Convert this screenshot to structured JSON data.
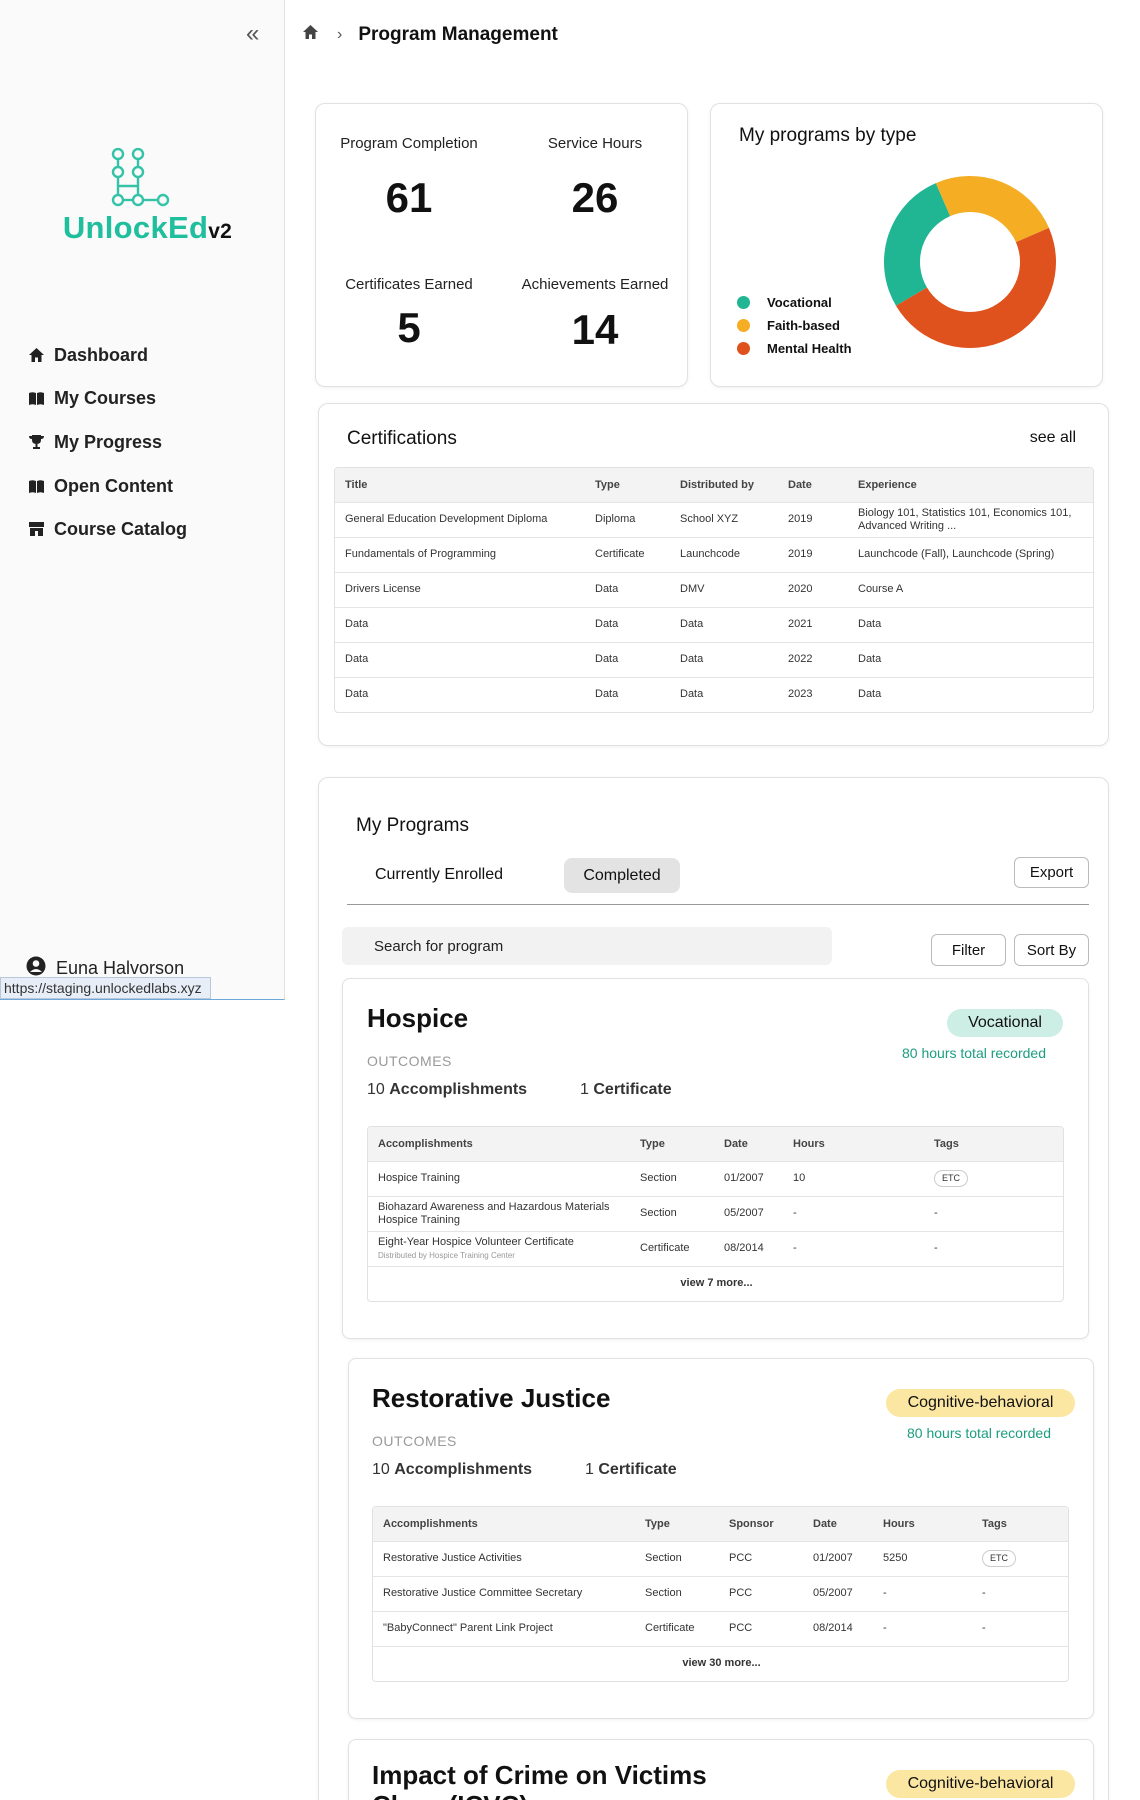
{
  "app": {
    "logo_text": "UnlockEd",
    "logo_version": "v2"
  },
  "sidebar": {
    "items": [
      {
        "label": "Dashboard",
        "icon": "home-icon"
      },
      {
        "label": "My Courses",
        "icon": "book-icon"
      },
      {
        "label": "My Progress",
        "icon": "trophy-icon"
      },
      {
        "label": "Open Content",
        "icon": "book-icon"
      },
      {
        "label": "Course Catalog",
        "icon": "store-icon"
      }
    ],
    "user_name": "Euna Halvorson",
    "url_tooltip": "https://staging.unlockedlabs.xyz"
  },
  "breadcrumb": {
    "title": "Program Management"
  },
  "stats": {
    "program_completion_label": "Program Completion",
    "program_completion_value": "61",
    "service_hours_label": "Service Hours",
    "service_hours_value": "26",
    "certificates_label": "Certificates Earned",
    "certificates_value": "5",
    "achievements_label": "Achievements Earned",
    "achievements_value": "14"
  },
  "programs_by_type": {
    "title": "My programs by type",
    "legend": [
      "Vocational",
      "Faith-based",
      "Mental Health"
    ]
  },
  "chart_data": {
    "type": "pie",
    "title": "My programs by type",
    "categories": [
      "Vocational",
      "Faith-based",
      "Mental Health"
    ],
    "values": [
      27,
      25,
      48
    ],
    "colors": [
      "#20b593",
      "#f5ae23",
      "#e0521d"
    ],
    "legend_position": "left"
  },
  "certifications": {
    "title": "Certifications",
    "see_all": "see all",
    "columns": [
      "Title",
      "Type",
      "Distributed by",
      "Date",
      "Experience"
    ],
    "rows": [
      [
        "General Education Development Diploma",
        "Diploma",
        "School XYZ",
        "2019",
        "Biology 101, Statistics 101, Economics 101, Advanced Writing ..."
      ],
      [
        "Fundamentals of Programming",
        "Certificate",
        "Launchcode",
        "2019",
        "Launchcode (Fall), Launchcode (Spring)"
      ],
      [
        "Drivers License",
        "Data",
        "DMV",
        "2020",
        "Course A"
      ],
      [
        "Data",
        "Data",
        "Data",
        "2021",
        "Data"
      ],
      [
        "Data",
        "Data",
        "Data",
        "2022",
        "Data"
      ],
      [
        "Data",
        "Data",
        "Data",
        "2023",
        "Data"
      ]
    ]
  },
  "my_programs": {
    "title": "My Programs",
    "tab_enrolled": "Currently Enrolled",
    "tab_completed": "Completed",
    "export": "Export",
    "search_placeholder": "Search for program",
    "filter": "Filter",
    "sort_by": "Sort By",
    "programs": [
      {
        "name": "Hospice",
        "type": "Vocational",
        "hours": "80 hours total recorded",
        "outcomes_label": "OUTCOMES",
        "accomplishments_count": "10",
        "accomplishments_label": "Accomplishments",
        "certificate_count": "1",
        "certificate_label": "Certificate",
        "columns": [
          "Accomplishments",
          "Type",
          "Date",
          "Hours",
          "Tags"
        ],
        "rows": [
          {
            "name": "Hospice Training",
            "sub": "",
            "type": "Section",
            "date": "01/2007",
            "hours": "10",
            "tags": "ETC"
          },
          {
            "name": "Biohazard Awareness and Hazardous Materials Hospice Training",
            "sub": "",
            "type": "Section",
            "date": "05/2007",
            "hours": "-",
            "tags": "-"
          },
          {
            "name": "Eight-Year Hospice Volunteer Certificate",
            "sub": "Distributed by Hospice Training Center",
            "type": "Certificate",
            "date": "08/2014",
            "hours": "-",
            "tags": "-"
          }
        ],
        "more": "view 7 more..."
      },
      {
        "name": "Restorative Justice",
        "type": "Cognitive-behavioral",
        "hours": "80 hours total recorded",
        "outcomes_label": "OUTCOMES",
        "accomplishments_count": "10",
        "accomplishments_label": "Accomplishments",
        "certificate_count": "1",
        "certificate_label": "Certificate",
        "columns": [
          "Accomplishments",
          "Type",
          "Sponsor",
          "Date",
          "Hours",
          "Tags"
        ],
        "rows": [
          {
            "name": "Restorative Justice Activities",
            "type": "Section",
            "sponsor": "PCC",
            "date": "01/2007",
            "hours": "5250",
            "tags": "ETC"
          },
          {
            "name": "Restorative Justice Committee Secretary",
            "type": "Section",
            "sponsor": "PCC",
            "date": "05/2007",
            "hours": "-",
            "tags": "-"
          },
          {
            "name": "\"BabyConnect\" Parent Link Project",
            "type": "Certificate",
            "sponsor": "PCC",
            "date": "08/2014",
            "hours": "-",
            "tags": "-"
          }
        ],
        "more": "view 30 more..."
      },
      {
        "name": "Impact of Crime on Victims Class (ICVC)",
        "type": "Cognitive-behavioral"
      }
    ]
  }
}
